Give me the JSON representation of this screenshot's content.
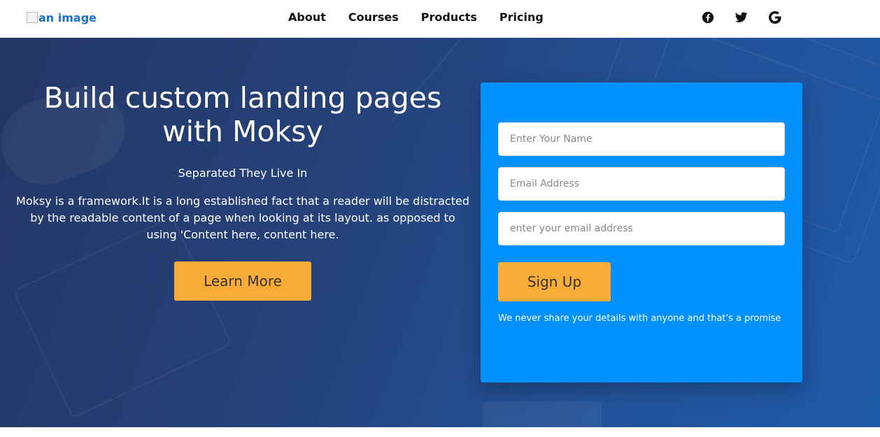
{
  "nav": {
    "logo_alt": "an image",
    "links": [
      "About",
      "Courses",
      "Products",
      "Pricing"
    ],
    "social_icons": [
      "facebook-icon",
      "twitter-icon",
      "google-icon"
    ]
  },
  "hero": {
    "title": "Build custom landing pages with Moksy",
    "subtitle": "Separated They Live In",
    "description": "Moksy is a framework.It is a long established fact that a reader will be distracted by the readable content of a page when looking at its layout. as opposed to using 'Content here, content here.",
    "cta_label": "Learn More"
  },
  "form": {
    "name_placeholder": "Enter Your Name",
    "email_placeholder": "Email Address",
    "email2_placeholder": "enter your email address",
    "submit_label": "Sign Up",
    "note": "We never share your details with anyone and that's a promise"
  },
  "colors": {
    "accent": "#f9ac37",
    "form_bg": "#0091ff",
    "hero_bg": "#25427a"
  }
}
